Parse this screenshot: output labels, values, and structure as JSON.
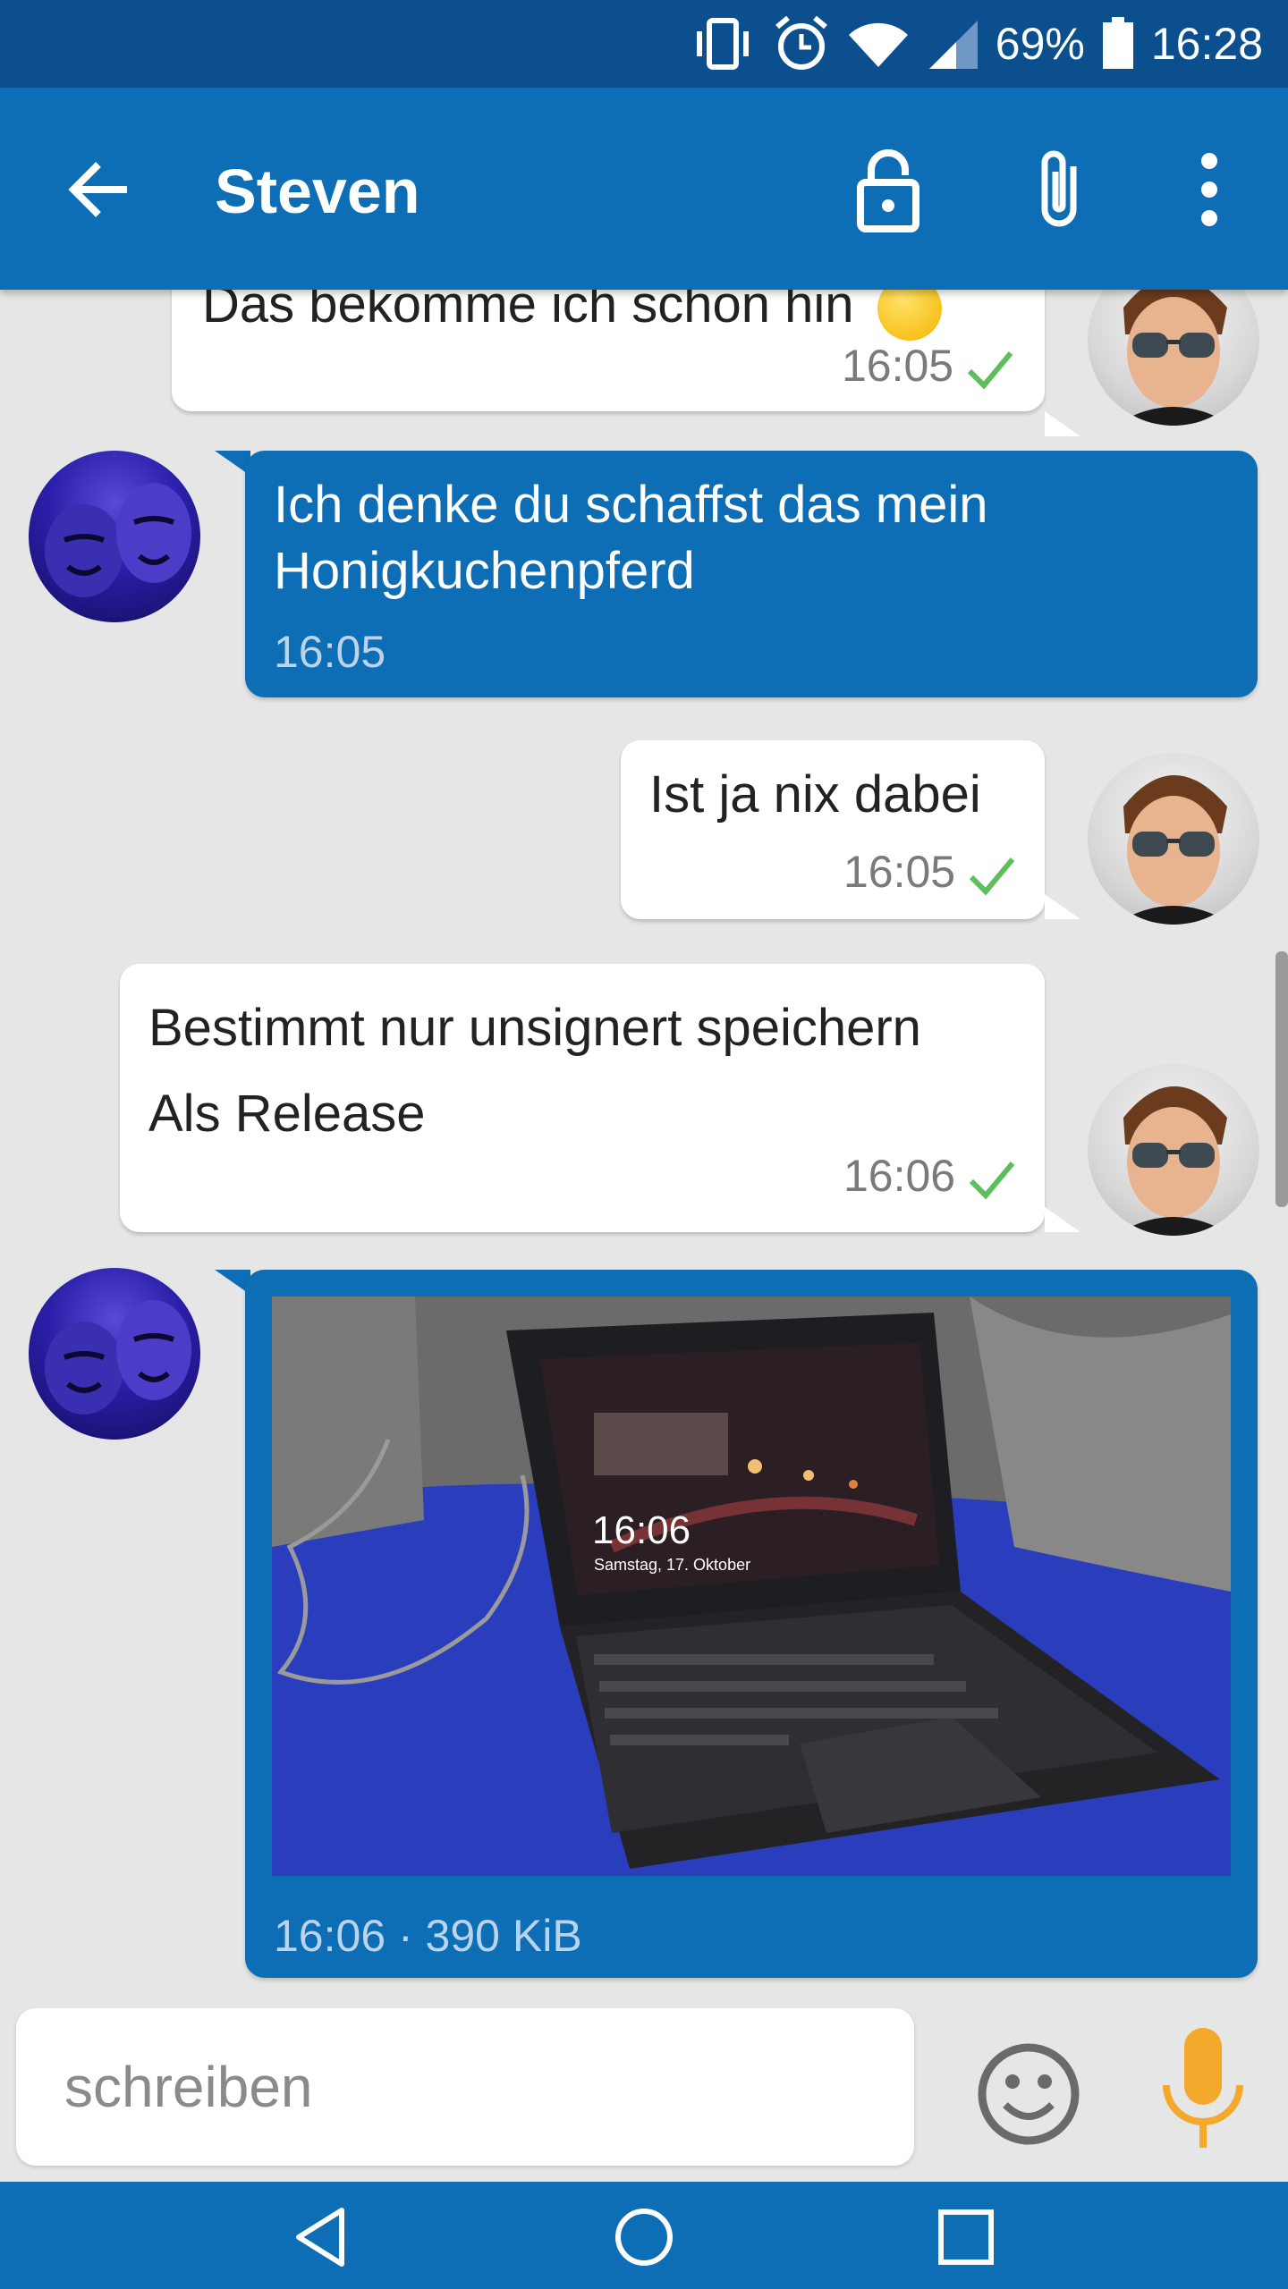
{
  "status_bar": {
    "battery": "69%",
    "time": "16:28",
    "icons": [
      "vibrate-icon",
      "alarm-icon",
      "wifi-icon",
      "signal-icon",
      "battery-icon"
    ]
  },
  "toolbar": {
    "title": "Steven",
    "icons": [
      "back-arrow-icon",
      "lock-icon",
      "attachment-icon",
      "more-vert-icon"
    ]
  },
  "messages": [
    {
      "direction": "incoming",
      "text": "Das bekomme ich schon hin",
      "time": "16:05",
      "status": "delivered"
    },
    {
      "direction": "outgoing",
      "text": "Ich denke du schaffst das mein Honigkuchenpferd",
      "time": "16:05"
    },
    {
      "direction": "incoming",
      "text": "Ist ja nix dabei",
      "time": "16:05",
      "status": "delivered"
    },
    {
      "direction": "incoming",
      "line1": "Bestimmt nur unsignert speichern",
      "line2": "Als Release",
      "time": "16:06",
      "status": "delivered"
    },
    {
      "direction": "outgoing",
      "type": "image",
      "meta": "16:06 · 390 KiB",
      "photo_clock": "16:06",
      "photo_date": "Samstag, 17. Oktober"
    }
  ],
  "composer": {
    "placeholder": "schreiben",
    "emoji_icon": "emoji-icon",
    "mic_icon": "microphone-icon"
  },
  "colors": {
    "status_bar": "#0b4f8e",
    "toolbar": "#0d6db5",
    "outgoing_bubble": "#0d6db5",
    "incoming_bubble": "#ffffff",
    "check": "#5cbf5c",
    "mic": "#f4a92d"
  }
}
